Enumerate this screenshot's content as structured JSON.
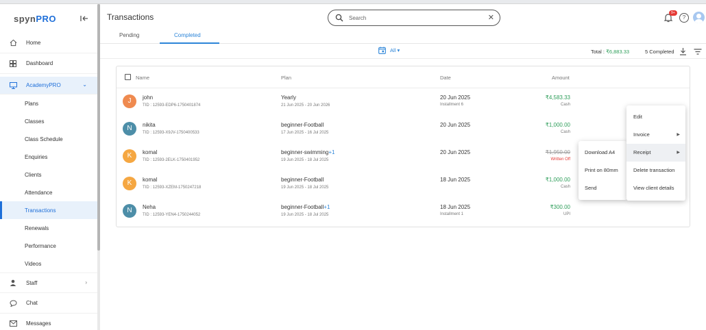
{
  "sidebar": {
    "logo_prefix": "spyn",
    "logo_suffix": "PRO",
    "items": {
      "home": "Home",
      "dashboard": "Dashboard",
      "academy": "AcademyPRO",
      "staff": "Staff",
      "chat": "Chat",
      "messages": "Messages"
    },
    "sub_items": [
      "Plans",
      "Classes",
      "Class Schedule",
      "Enquiries",
      "Clients",
      "Attendance",
      "Transactions",
      "Renewals",
      "Performance",
      "Videos"
    ],
    "active_sub_item": "Transactions"
  },
  "header": {
    "title": "Transactions",
    "search_placeholder": "Search",
    "notification_badge": "9+"
  },
  "tabs": {
    "pending": "Pending",
    "completed": "Completed",
    "active": "Completed"
  },
  "filter": {
    "range": "All",
    "total_label": "Total : ",
    "total_amount": "₹6,883.33",
    "completed_count": "5 Completed"
  },
  "table": {
    "headers": {
      "name": "Name",
      "plan": "Plan",
      "date": "Date",
      "amount": "Amount"
    },
    "rows": [
      {
        "initial": "J",
        "avatar_color": "#ef8a4f",
        "name": "john",
        "tid": "TID : 12593-EDP6-1750401874",
        "plan": "Yearly",
        "plan_extra": "",
        "period": "21 Jun 2025 - 20 Jun 2026",
        "date": "20 Jun 2025",
        "installment": "Installment 6",
        "amount": "₹4,583.33",
        "mode": "Cash",
        "strike": false
      },
      {
        "initial": "N",
        "avatar_color": "#4d8ea8",
        "name": "nikita",
        "tid": "TID : 12593-X9JV-1750400533",
        "plan": "beginner-Football",
        "plan_extra": "",
        "period": "17 Jun 2025 - 16 Jul 2025",
        "date": "20 Jun 2025",
        "installment": "",
        "amount": "₹1,000.00",
        "mode": "Cash",
        "strike": false
      },
      {
        "initial": "K",
        "avatar_color": "#f5a742",
        "name": "komal",
        "tid": "TID : 12593-2ELK-1750401952",
        "plan": "beginner-swimming",
        "plan_extra": "+1",
        "period": "19 Jun 2025 - 18 Jul 2025",
        "date": "20 Jun 2025",
        "installment": "",
        "amount": "₹1,950.00",
        "mode": "Written Off",
        "strike": true
      },
      {
        "initial": "K",
        "avatar_color": "#f5a742",
        "name": "komal",
        "tid": "TID : 12593-XZEM-1750247218",
        "plan": "beginner-Football",
        "plan_extra": "",
        "period": "19 Jun 2025 - 18 Jul 2025",
        "date": "18 Jun 2025",
        "installment": "",
        "amount": "₹1,000.00",
        "mode": "Cash",
        "strike": false
      },
      {
        "initial": "N",
        "avatar_color": "#4d8ea8",
        "name": "Neha",
        "tid": "TID : 12593-YEN4-1750244052",
        "plan": "beginner-Football",
        "plan_extra": "+1",
        "period": "19 Jun 2025 - 18 Jul 2025",
        "date": "18 Jun 2025",
        "installment": "Installment 1",
        "amount": "₹300.00",
        "mode": "UPI",
        "strike": false
      }
    ]
  },
  "context_menu": {
    "items": [
      "Edit",
      "Invoice",
      "Receipt",
      "Delete transaction",
      "View client details"
    ],
    "hovered": "Receipt",
    "receipt_submenu": [
      "Download A4",
      "Print on 80mm",
      "Send"
    ]
  },
  "colors": {
    "accent": "#2b84d8",
    "positive": "#2e9e5a",
    "negative": "#e53935"
  }
}
